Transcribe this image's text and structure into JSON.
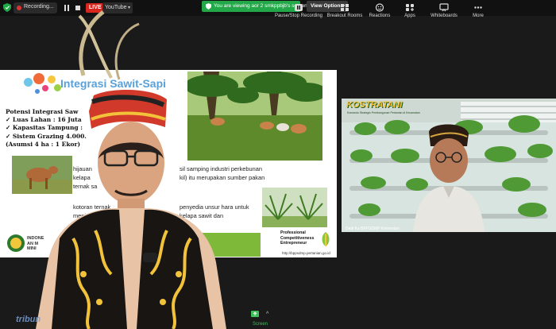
{
  "topbar": {
    "recording_label": "Recording...",
    "live_label": "LIVE",
    "platform_label": "YouTube",
    "viewing_banner": "You are viewing aor 2 smkppbjb's screen",
    "view_options_label": "View Options"
  },
  "slide": {
    "title": "Integrasi Sawit-Sapi",
    "potensi_lines": [
      "Potensi Integrasi Saw",
      "✓ Luas Lahan : 16 Juta",
      "✓ Kapasitas Tampung :",
      "✓ Sistem Grazing 4.000.",
      "   (Asumsi 4 ha : 1 Ekor)"
    ],
    "body_lines_1": [
      "hijauan",
      "kelapa",
      "ternak sa"
    ],
    "body_right_1": [
      "sil samping industri perkebunan",
      "kil) itu merupakan sumber pakan",
      ""
    ],
    "body_lines_2": [
      "kotoran ternak",
      "meningk"
    ],
    "body_right_2": [
      "penyedia unsur hara untuk",
      "kelapa sawit dan"
    ],
    "institution_lines": [
      "INDONE",
      "AN M",
      "MINI"
    ],
    "pce_lines": [
      "Professional",
      "Competitiveness",
      "Entrepreneur"
    ],
    "pce_url": "http://bppsdmp.pertanian.go.id"
  },
  "video2": {
    "banner_title": "KOSTRATANI",
    "banner_subtitle": "Komando Strategis Pembangunan Pertanian di Kecamatan",
    "participant_label": "Dedi Ka BPPSDMP Kementan"
  },
  "bottombar": {
    "screen_label": "Screen",
    "items": [
      {
        "label": "Pause/Stop Recording",
        "icon": "pause-icon"
      },
      {
        "label": "Breakout Rooms",
        "icon": "breakout-icon"
      },
      {
        "label": "Reactions",
        "icon": "reactions-icon"
      },
      {
        "label": "Apps",
        "icon": "apps-icon"
      },
      {
        "label": "Whiteboards",
        "icon": "whiteboard-icon"
      },
      {
        "label": "More",
        "icon": "more-icon"
      }
    ]
  },
  "watermark": "tribun"
}
